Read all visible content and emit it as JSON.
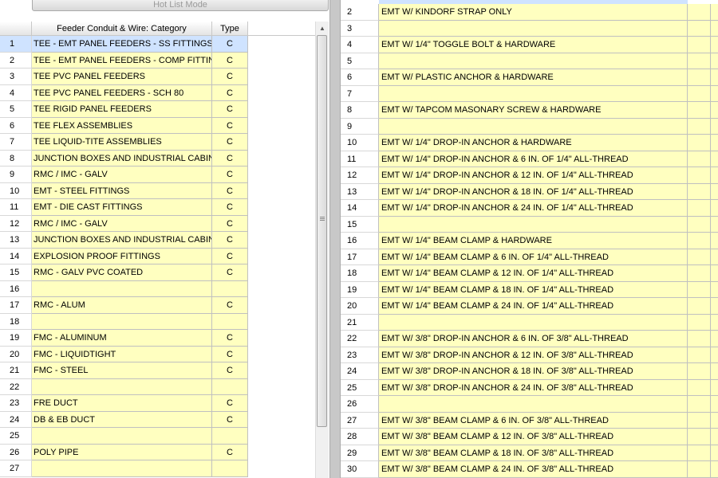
{
  "mode_bar": {
    "label": "Hot List Mode"
  },
  "left_grid": {
    "headers": {
      "number": "",
      "category": "Feeder Conduit & Wire: Category",
      "type": "Type"
    },
    "rows": [
      {
        "num": "1",
        "category": "TEE - EMT PANEL FEEDERS - SS FITTINGS",
        "type": "C"
      },
      {
        "num": "2",
        "category": "TEE - EMT PANEL FEEDERS - COMP FITTINGS",
        "type": "C"
      },
      {
        "num": "3",
        "category": "TEE PVC PANEL FEEDERS",
        "type": "C"
      },
      {
        "num": "4",
        "category": "TEE PVC PANEL FEEDERS - SCH 80",
        "type": "C"
      },
      {
        "num": "5",
        "category": "TEE RIGID PANEL FEEDERS",
        "type": "C"
      },
      {
        "num": "6",
        "category": "TEE FLEX ASSEMBLIES",
        "type": "C"
      },
      {
        "num": "7",
        "category": "TEE LIQUID-TITE ASSEMBLIES",
        "type": "C"
      },
      {
        "num": "8",
        "category": "JUNCTION BOXES AND INDUSTRIAL CABINETS",
        "type": "C"
      },
      {
        "num": "9",
        "category": "RMC / IMC - GALV",
        "type": "C"
      },
      {
        "num": "10",
        "category": "EMT - STEEL FITTINGS",
        "type": "C"
      },
      {
        "num": "11",
        "category": "EMT - DIE CAST FITTINGS",
        "type": "C"
      },
      {
        "num": "12",
        "category": "RMC / IMC - GALV",
        "type": "C"
      },
      {
        "num": "13",
        "category": "JUNCTION BOXES AND INDUSTRIAL CABINETS",
        "type": "C"
      },
      {
        "num": "14",
        "category": "EXPLOSION PROOF FITTINGS",
        "type": "C"
      },
      {
        "num": "15",
        "category": "RMC - GALV PVC COATED",
        "type": "C"
      },
      {
        "num": "16",
        "category": "",
        "type": ""
      },
      {
        "num": "17",
        "category": "RMC - ALUM",
        "type": "C"
      },
      {
        "num": "18",
        "category": "",
        "type": ""
      },
      {
        "num": "19",
        "category": "FMC - ALUMINUM",
        "type": "C"
      },
      {
        "num": "20",
        "category": "FMC - LIQUIDTIGHT",
        "type": "C"
      },
      {
        "num": "21",
        "category": "FMC - STEEL",
        "type": "C"
      },
      {
        "num": "22",
        "category": "",
        "type": ""
      },
      {
        "num": "23",
        "category": "FRE DUCT",
        "type": "C"
      },
      {
        "num": "24",
        "category": "DB & EB DUCT",
        "type": "C"
      },
      {
        "num": "25",
        "category": "",
        "type": ""
      },
      {
        "num": "26",
        "category": "POLY PIPE",
        "type": "C"
      },
      {
        "num": "27",
        "category": "",
        "type": ""
      }
    ]
  },
  "right_grid": {
    "rows": [
      {
        "num": "2",
        "desc": "EMT W/ KINDORF STRAP ONLY"
      },
      {
        "num": "3",
        "desc": ""
      },
      {
        "num": "4",
        "desc": "EMT W/ 1/4\" TOGGLE BOLT & HARDWARE"
      },
      {
        "num": "5",
        "desc": ""
      },
      {
        "num": "6",
        "desc": "EMT W/ PLASTIC ANCHOR & HARDWARE"
      },
      {
        "num": "7",
        "desc": ""
      },
      {
        "num": "8",
        "desc": "EMT W/ TAPCOM MASONARY SCREW & HARDWARE"
      },
      {
        "num": "9",
        "desc": ""
      },
      {
        "num": "10",
        "desc": "EMT W/ 1/4\" DROP-IN ANCHOR & HARDWARE"
      },
      {
        "num": "11",
        "desc": "EMT W/ 1/4\" DROP-IN ANCHOR & 6 IN. OF 1/4\" ALL-THREAD"
      },
      {
        "num": "12",
        "desc": "EMT W/ 1/4\" DROP-IN ANCHOR & 12 IN. OF 1/4\" ALL-THREAD"
      },
      {
        "num": "13",
        "desc": "EMT W/ 1/4\" DROP-IN ANCHOR & 18 IN. OF 1/4\" ALL-THREAD"
      },
      {
        "num": "14",
        "desc": "EMT W/ 1/4\" DROP-IN ANCHOR & 24 IN. OF 1/4\" ALL-THREAD"
      },
      {
        "num": "15",
        "desc": ""
      },
      {
        "num": "16",
        "desc": "EMT W/ 1/4\" BEAM CLAMP & HARDWARE"
      },
      {
        "num": "17",
        "desc": "EMT W/ 1/4\" BEAM CLAMP & 6 IN. OF 1/4\" ALL-THREAD"
      },
      {
        "num": "18",
        "desc": "EMT W/ 1/4\" BEAM CLAMP & 12 IN. OF 1/4\" ALL-THREAD"
      },
      {
        "num": "19",
        "desc": "EMT W/ 1/4\" BEAM CLAMP & 18 IN. OF 1/4\" ALL-THREAD"
      },
      {
        "num": "20",
        "desc": "EMT W/ 1/4\" BEAM CLAMP & 24 IN. OF 1/4\" ALL-THREAD"
      },
      {
        "num": "21",
        "desc": ""
      },
      {
        "num": "22",
        "desc": "EMT W/ 3/8\" DROP-IN ANCHOR & 6 IN. OF 3/8\" ALL-THREAD"
      },
      {
        "num": "23",
        "desc": "EMT W/ 3/8\" DROP-IN ANCHOR & 12 IN. OF 3/8\" ALL-THREAD"
      },
      {
        "num": "24",
        "desc": "EMT W/ 3/8\" DROP-IN ANCHOR & 18 IN. OF 3/8\" ALL-THREAD"
      },
      {
        "num": "25",
        "desc": "EMT W/ 3/8\" DROP-IN ANCHOR & 24 IN. OF 3/8\" ALL-THREAD"
      },
      {
        "num": "26",
        "desc": ""
      },
      {
        "num": "27",
        "desc": "EMT W/ 3/8\" BEAM CLAMP & 6 IN. OF 3/8\" ALL-THREAD"
      },
      {
        "num": "28",
        "desc": "EMT W/ 3/8\" BEAM CLAMP & 12 IN. OF 3/8\" ALL-THREAD"
      },
      {
        "num": "29",
        "desc": "EMT W/ 3/8\" BEAM CLAMP & 18 IN. OF 3/8\" ALL-THREAD"
      },
      {
        "num": "30",
        "desc": "EMT W/ 3/8\" BEAM CLAMP & 24 IN. OF 3/8\" ALL-THREAD"
      }
    ]
  },
  "colors": {
    "cell_yellow": "#ffffc0",
    "selected_blue": "#cfe3ff",
    "grid_line": "#c0c0c0"
  },
  "icons": {
    "scroll_up": "scroll-up-arrow-icon",
    "grip": "scroll-grip-icon"
  }
}
